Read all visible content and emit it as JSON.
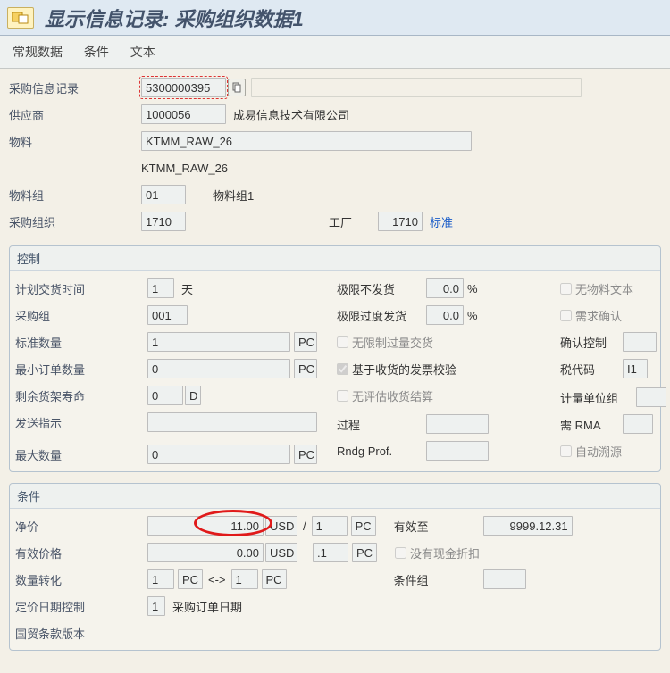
{
  "window": {
    "title": "显示信息记录: 采购组织数据1"
  },
  "menu": {
    "general": "常规数据",
    "conditions": "条件",
    "texts": "文本"
  },
  "header": {
    "infoRecord_label": "采购信息记录",
    "infoRecord": "5300000395",
    "vendor_label": "供应商",
    "vendor": "1000056",
    "vendor_name": "成易信息技术有限公司",
    "material_label": "物料",
    "material": "KTMM_RAW_26",
    "material_desc": "KTMM_RAW_26",
    "matGroup_label": "物料组",
    "matGroup": "01",
    "matGroup_desc": "物料组1",
    "purchOrg_label": "采购组织",
    "purchOrg": "1710",
    "plant_label": "工厂",
    "plant": "1710",
    "plant_desc": "标准"
  },
  "control": {
    "title": "控制",
    "plannedDelivery_label": "计划交货时间",
    "plannedDelivery": "1",
    "days": "天",
    "purchGroup_label": "采购组",
    "purchGroup": "001",
    "stdQty_label": "标准数量",
    "stdQty": "1",
    "unit_pc": "PC",
    "minQty_label": "最小订单数量",
    "minQty": "0",
    "shelfLife_label": "剩余货架寿命",
    "shelfLife": "0",
    "shelfLife_unit": "D",
    "shipInstr_label": "发送指示",
    "maxQty_label": "最大数量",
    "maxQty": "0",
    "underTol_label": "极限不发货",
    "underTol": "0.0",
    "overTol_label": "极限过度发货",
    "overTol": "0.0",
    "pct": "%",
    "chk_unlimited": "无限制过量交货",
    "chk_gr_iv": "基于收货的发票校验",
    "chk_no_ers": "无评估收货结算",
    "process_label": "过程",
    "rndg_label": "Rndg Prof.",
    "chk_no_mtext": "无物料文本",
    "chk_ack_req": "需求确认",
    "chk_auto_src": "自动溯源",
    "confCtrl_label": "确认控制",
    "taxCode_label": "税代码",
    "taxCode": "I1",
    "uomGroup_label": "计量单位组",
    "rma_label": "需 RMA"
  },
  "conditions": {
    "title": "条件",
    "netPrice_label": "净价",
    "netPrice": "11.00",
    "currency": "USD",
    "per": "1",
    "unit": "PC",
    "effPrice_label": "有效价格",
    "effPrice": "0.00",
    "effPer": ".1",
    "validTo_label": "有效至",
    "validTo": "9999.12.31",
    "chk_no_cash_disc": "没有现金折扣",
    "qtyConv_label": "数量转化",
    "qtyConv_from": "1",
    "qtyConv_fromUnit": "PC",
    "arrow": "<->",
    "qtyConv_to": "1",
    "qtyConv_toUnit": "PC",
    "condGroup_label": "条件组",
    "dateCtrl_label": "定价日期控制",
    "dateCtrl": "1",
    "dateCtrl_desc": "采购订单日期",
    "incoterms_label": "国贸条款版本"
  }
}
